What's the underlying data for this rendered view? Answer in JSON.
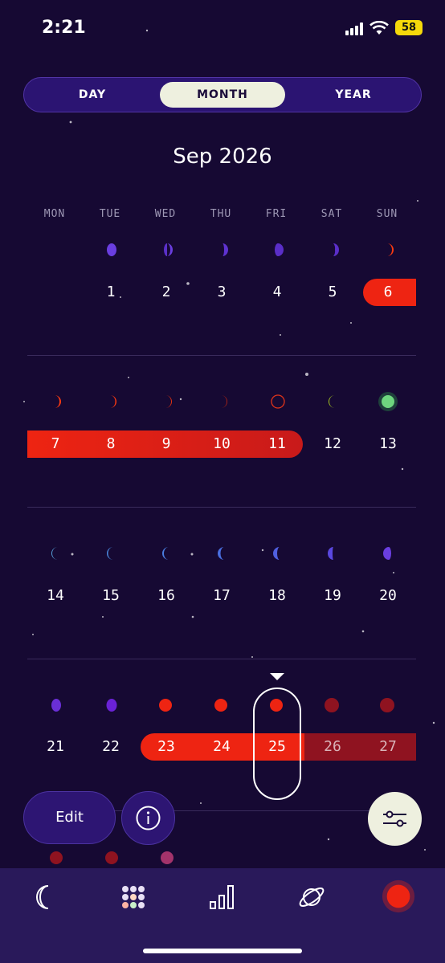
{
  "status_bar": {
    "time": "2:21",
    "battery": "58"
  },
  "view_switcher": {
    "options": [
      "DAY",
      "MONTH",
      "YEAR"
    ],
    "selected": "MONTH"
  },
  "calendar": {
    "title": "Sep 2026",
    "weekdays": [
      "MON",
      "TUE",
      "WED",
      "THU",
      "FRI",
      "SAT",
      "SUN"
    ],
    "weeks": [
      [
        "",
        "1",
        "2",
        "3",
        "4",
        "5",
        "6"
      ],
      [
        "7",
        "8",
        "9",
        "10",
        "11",
        "12",
        "13"
      ],
      [
        "14",
        "15",
        "16",
        "17",
        "18",
        "19",
        "20"
      ],
      [
        "21",
        "22",
        "23",
        "24",
        "25",
        "26",
        "27"
      ]
    ],
    "selected_day": "25"
  },
  "actions": {
    "edit_label": "Edit"
  },
  "tab_bar": {
    "tabs": [
      "moon-icon",
      "calendar-grid-icon",
      "stats-icon",
      "planet-icon",
      "cycle-icon"
    ],
    "active": "calendar-grid-icon"
  },
  "colors": {
    "accent_red": "#e8200f",
    "dark_red": "#8f1320",
    "purple": "#6a2fd6",
    "background": "#160933",
    "segment_active": "#eef0df"
  }
}
